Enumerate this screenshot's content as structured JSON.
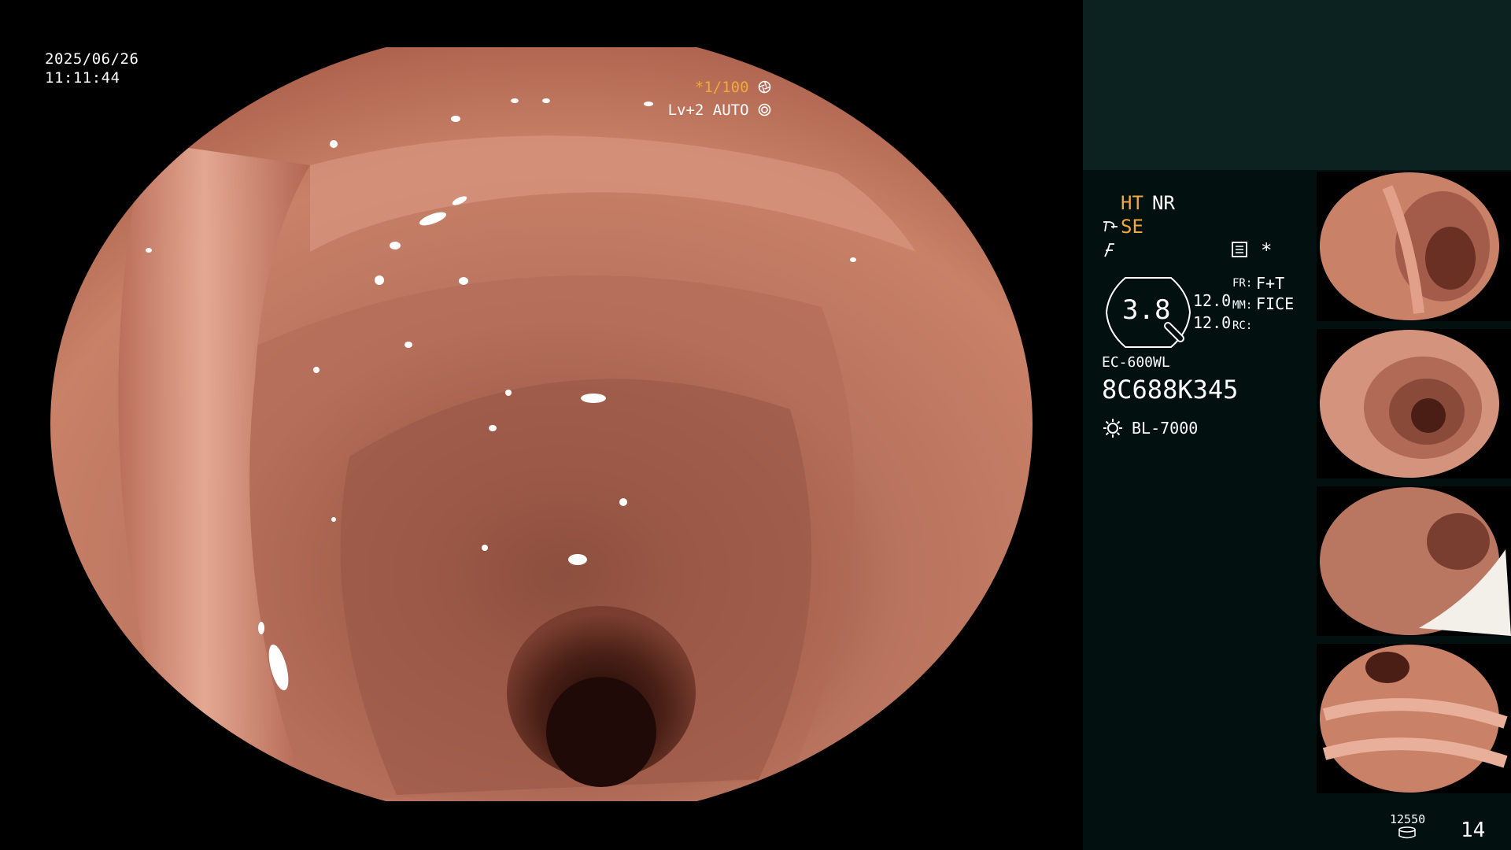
{
  "overlay": {
    "date": "2025/06/26",
    "time": "11:11:44",
    "shutter": "*1/100",
    "shutter_icon": "aperture-icon",
    "iris": "Lv+2 AUTO",
    "iris_icon": "aperture-ring-icon"
  },
  "panel": {
    "ht": "HT",
    "nr": "NR",
    "se": "SE",
    "se_icon": "structure-enhance-icon",
    "color_icon": "color-enhance-icon",
    "memory_icon": "memory-card-icon",
    "star": "*",
    "zoom_value": "3.8",
    "val1": "12.0",
    "val2": "12.0",
    "fr_label": "FR:",
    "fr_value": "F+T",
    "mm_label": "MM:",
    "mm_value": "FICE",
    "rc_label": "RC:",
    "rc_value": "",
    "scope_model": "EC-600WL",
    "serial": "8C688K345",
    "light_icon": "light-source-icon",
    "light_source": "BL-7000",
    "storage_count": "12550",
    "storage_icon": "storage-disk-icon",
    "image_count": "14"
  },
  "thumbnails": [
    {
      "label": "captured-image-1"
    },
    {
      "label": "captured-image-2"
    },
    {
      "label": "captured-image-3"
    },
    {
      "label": "captured-image-4"
    }
  ],
  "colors": {
    "amber": "#f2a93b",
    "panel_bg": "#02100f",
    "panel_top_bg": "#0b2221",
    "tissue": "#c27a64"
  }
}
